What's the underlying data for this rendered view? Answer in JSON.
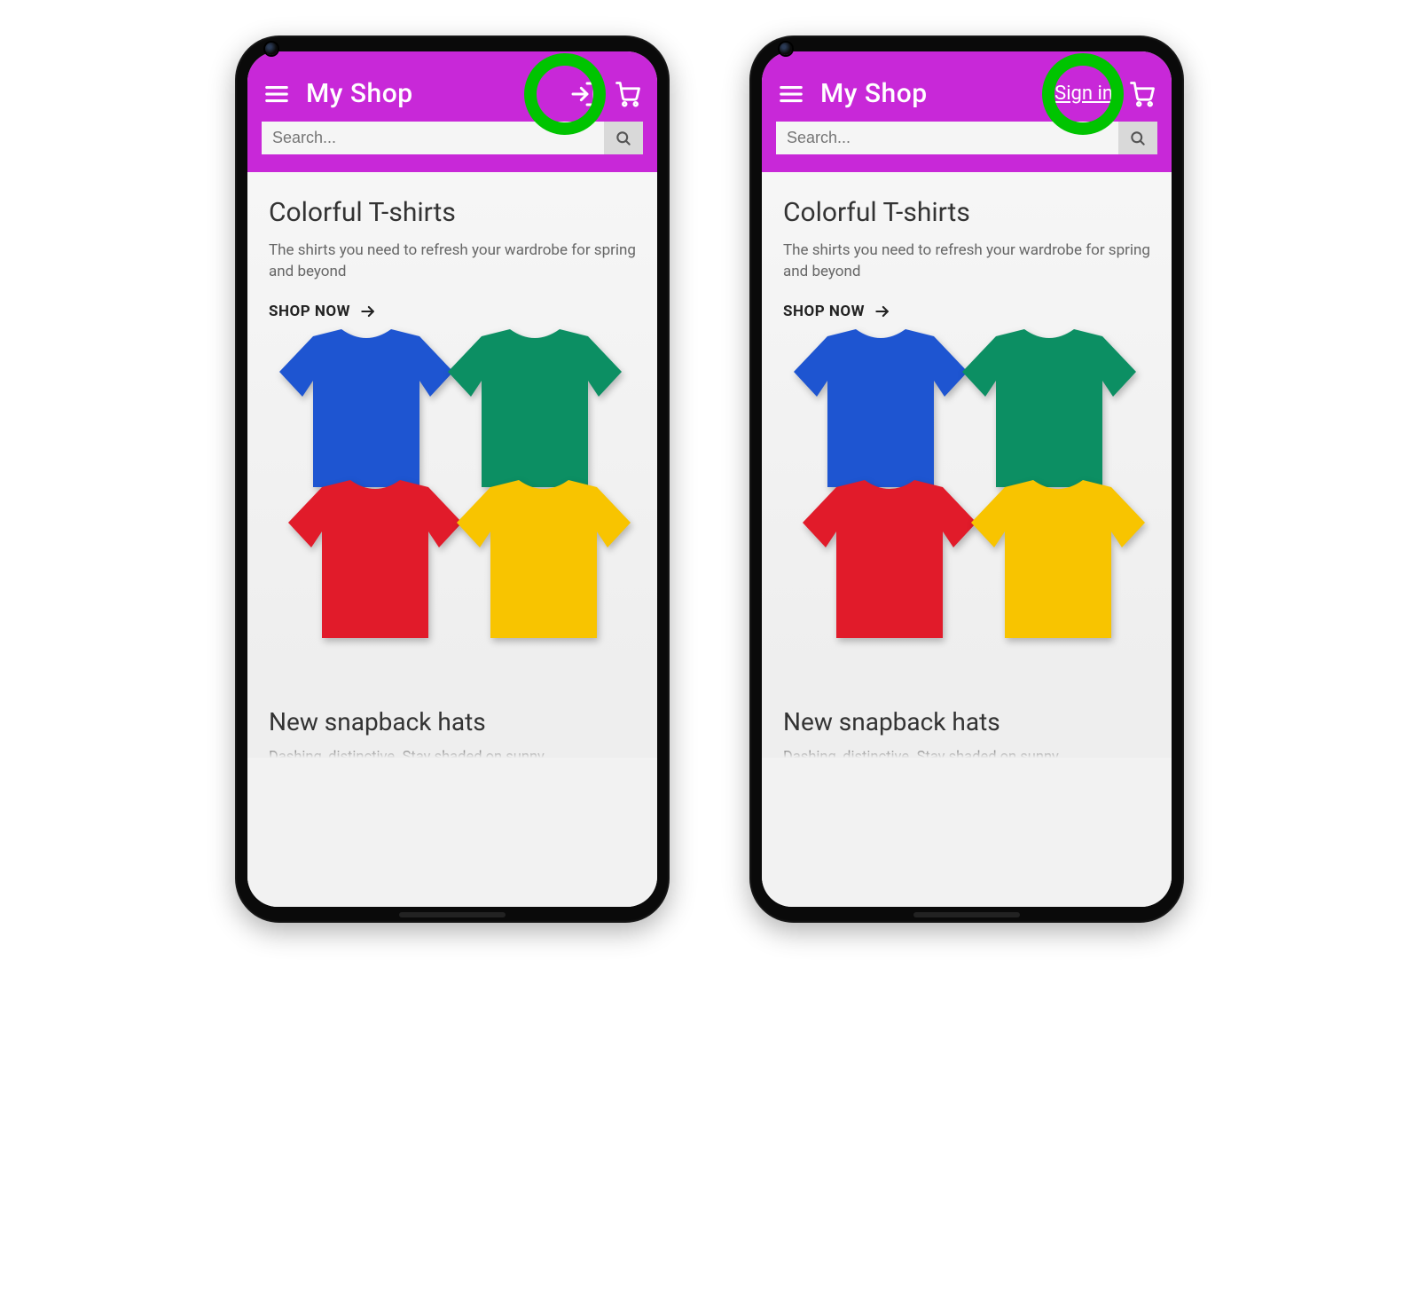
{
  "header": {
    "brand": "My Shop",
    "signin_label": "Sign in",
    "search_placeholder": "Search..."
  },
  "highlight": {
    "left_variant": "login-icon",
    "right_variant": "signin-text"
  },
  "section1": {
    "title": "Colorful T-shirts",
    "subtitle": "The shirts you need to refresh your wardrobe for spring and beyond",
    "cta": "SHOP NOW",
    "shirts": [
      {
        "name": "blue",
        "color": "#1e55d1"
      },
      {
        "name": "green",
        "color": "#0c8f63"
      },
      {
        "name": "red",
        "color": "#e11b2a"
      },
      {
        "name": "yellow",
        "color": "#f8c400"
      }
    ]
  },
  "section2": {
    "title": "New snapback hats",
    "subtitle_partial": "Dashing, distinctive. Stay shaded on sunny"
  }
}
